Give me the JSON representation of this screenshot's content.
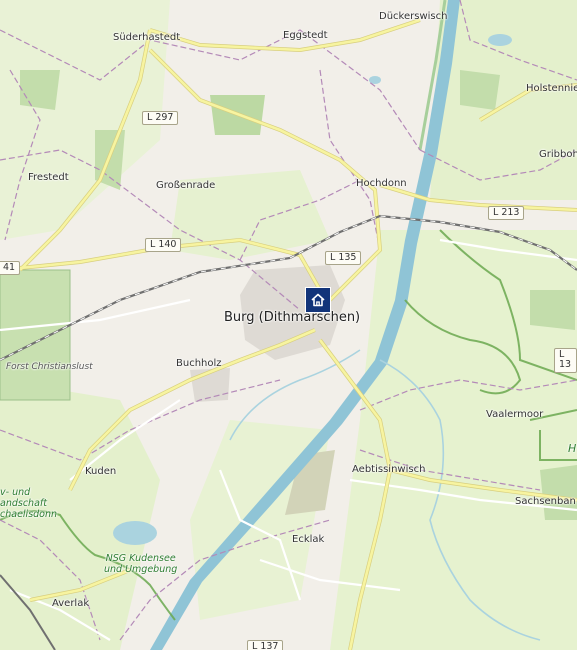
{
  "marker": {
    "icon": "home-icon",
    "color": "#12347a"
  },
  "places": {
    "suderhastedt": "Süderhastedt",
    "eggstedt": "Eggstedt",
    "duckerswisch": "Dückerswisch",
    "holstenniendorf": "Holstennie",
    "gribbohm": "Gribboh",
    "frestedt": "Frestedt",
    "grossenrade": "Großenrade",
    "hochdonn": "Hochdonn",
    "burg": "Burg (Dithmarschen)",
    "buchholz": "Buchholz",
    "vaalermoor": "Vaalermoor",
    "kuden": "Kuden",
    "aebtissinwisch": "Aebtissinwisch",
    "sachsenbande": "Sachsenban",
    "ecklak": "Ecklak",
    "averlak": "Averlak"
  },
  "roads": {
    "l297": "L 297",
    "l140": "L 140",
    "l135": "L 135",
    "l213": "L 213",
    "l13": "L 13",
    "l41": "41",
    "l137": "L 137"
  },
  "areas": {
    "forst": "Forst Christianslust",
    "nsg_kudensee": "NSG Kudensee\nund Umgebung",
    "landschaft": "v- und\nandschaft\nchaelisdonn",
    "h": "H"
  },
  "colors": {
    "land": "#f2efe9",
    "meadow": "#e2f0c8",
    "forest": "#b8d89c",
    "water": "#aad3df",
    "canal": "#8fc4d6",
    "road_major": "#f7f4a0",
    "boundary": "#b48ab8",
    "nature_reserve": "#6aa84f",
    "railway": "#707070"
  }
}
